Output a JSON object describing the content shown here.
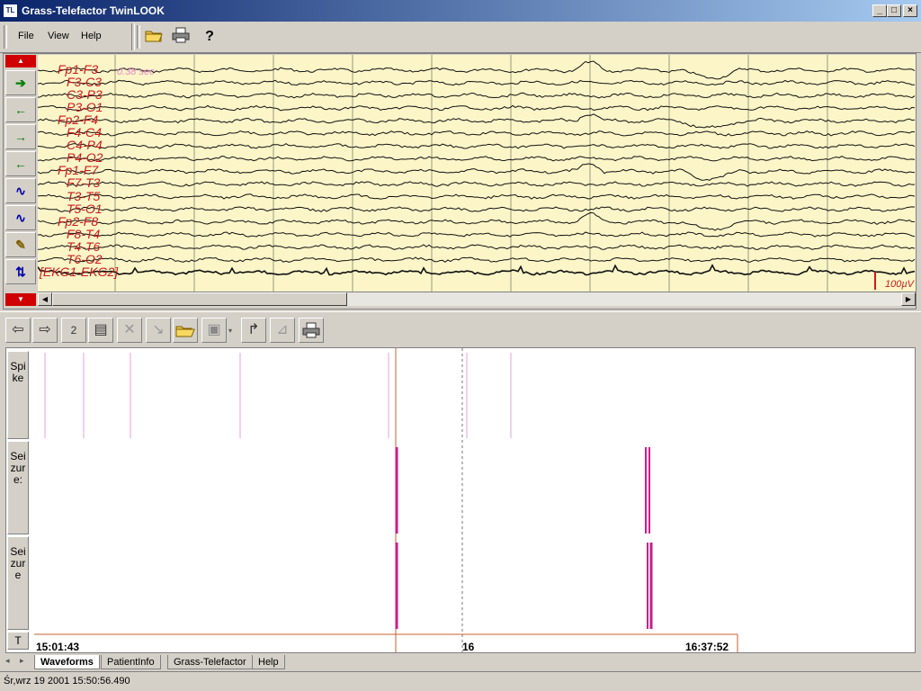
{
  "window": {
    "title": "Grass-Telefactor TwinLOOK",
    "icon_text": "TL",
    "minimize": "_",
    "maximize": "□",
    "close": "×"
  },
  "menu": {
    "items": [
      "File",
      "View",
      "Help"
    ]
  },
  "toolbar_icons": [
    "open-folder-icon",
    "print-icon",
    "help-icon"
  ],
  "eeg": {
    "channels": [
      "Fp1-F3",
      "F3-C3",
      "C3-P3",
      "P3-O1",
      "Fp2-F4",
      "F4-C4",
      "C4-P4",
      "P4-O2",
      "Fp1-F7",
      "F7-T3",
      "T3-T5",
      "T5-O1",
      "Fp2-F8",
      "F8-T4",
      "T4-T6",
      "T6-O2",
      "EKG1-EKG2"
    ],
    "time_label": "0.38 sec",
    "scale_label": "100µV",
    "colors": {
      "background": "#fbf5c8",
      "label": "#cc1c1c",
      "gridline": "#9a9a7a",
      "trace": "#111111"
    }
  },
  "toolbar2": {
    "page_number": "2"
  },
  "events": {
    "rows": [
      {
        "label": "Spike"
      },
      {
        "label": "Seizure:"
      },
      {
        "label": "Seizure"
      },
      {
        "label": "T"
      }
    ],
    "time_start": "15:01:43",
    "time_mid": "16",
    "time_end": "16:37:52",
    "marker_color": "#cc1c8c"
  },
  "tabs": [
    "Waveforms",
    "PatientInfo",
    "Grass-Telefactor",
    "Help"
  ],
  "status": {
    "text": "Śr,wrz 19 2001  15:50:56.490"
  }
}
